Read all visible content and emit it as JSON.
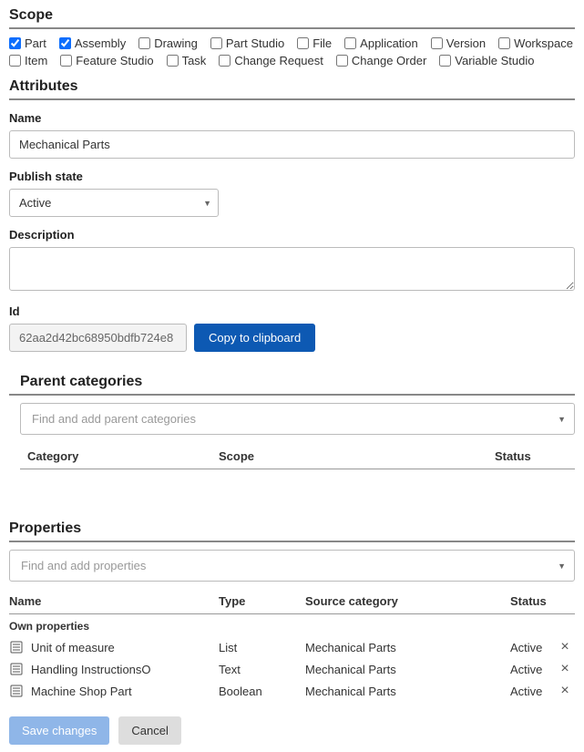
{
  "scope": {
    "header": "Scope",
    "items": [
      {
        "label": "Part",
        "checked": true
      },
      {
        "label": "Assembly",
        "checked": true
      },
      {
        "label": "Drawing",
        "checked": false
      },
      {
        "label": "Part Studio",
        "checked": false
      },
      {
        "label": "File",
        "checked": false
      },
      {
        "label": "Application",
        "checked": false
      },
      {
        "label": "Version",
        "checked": false
      },
      {
        "label": "Workspace",
        "checked": false
      },
      {
        "label": "Item",
        "checked": false
      },
      {
        "label": "Feature Studio",
        "checked": false
      },
      {
        "label": "Task",
        "checked": false
      },
      {
        "label": "Change Request",
        "checked": false
      },
      {
        "label": "Change Order",
        "checked": false
      },
      {
        "label": "Variable Studio",
        "checked": false
      }
    ]
  },
  "attributes": {
    "header": "Attributes",
    "name_label": "Name",
    "name_value": "Mechanical Parts",
    "publish_label": "Publish state",
    "publish_value": "Active",
    "description_label": "Description",
    "description_value": "",
    "id_label": "Id",
    "id_value": "62aa2d42bc68950bdfb724e8",
    "copy_label": "Copy to clipboard"
  },
  "parent_categories": {
    "header": "Parent categories",
    "placeholder": "Find and add parent categories",
    "col_category": "Category",
    "col_scope": "Scope",
    "col_status": "Status"
  },
  "properties": {
    "header": "Properties",
    "placeholder": "Find and add properties",
    "col_name": "Name",
    "col_type": "Type",
    "col_source": "Source category",
    "col_status": "Status",
    "own_label": "Own properties",
    "rows": [
      {
        "name": "Unit of measure",
        "type": "List",
        "source": "Mechanical Parts",
        "status": "Active"
      },
      {
        "name": "Handling InstructionsO",
        "type": "Text",
        "source": "Mechanical Parts",
        "status": "Active"
      },
      {
        "name": "Machine Shop Part",
        "type": "Boolean",
        "source": "Mechanical Parts",
        "status": "Active"
      }
    ]
  },
  "footer": {
    "save": "Save changes",
    "cancel": "Cancel"
  }
}
